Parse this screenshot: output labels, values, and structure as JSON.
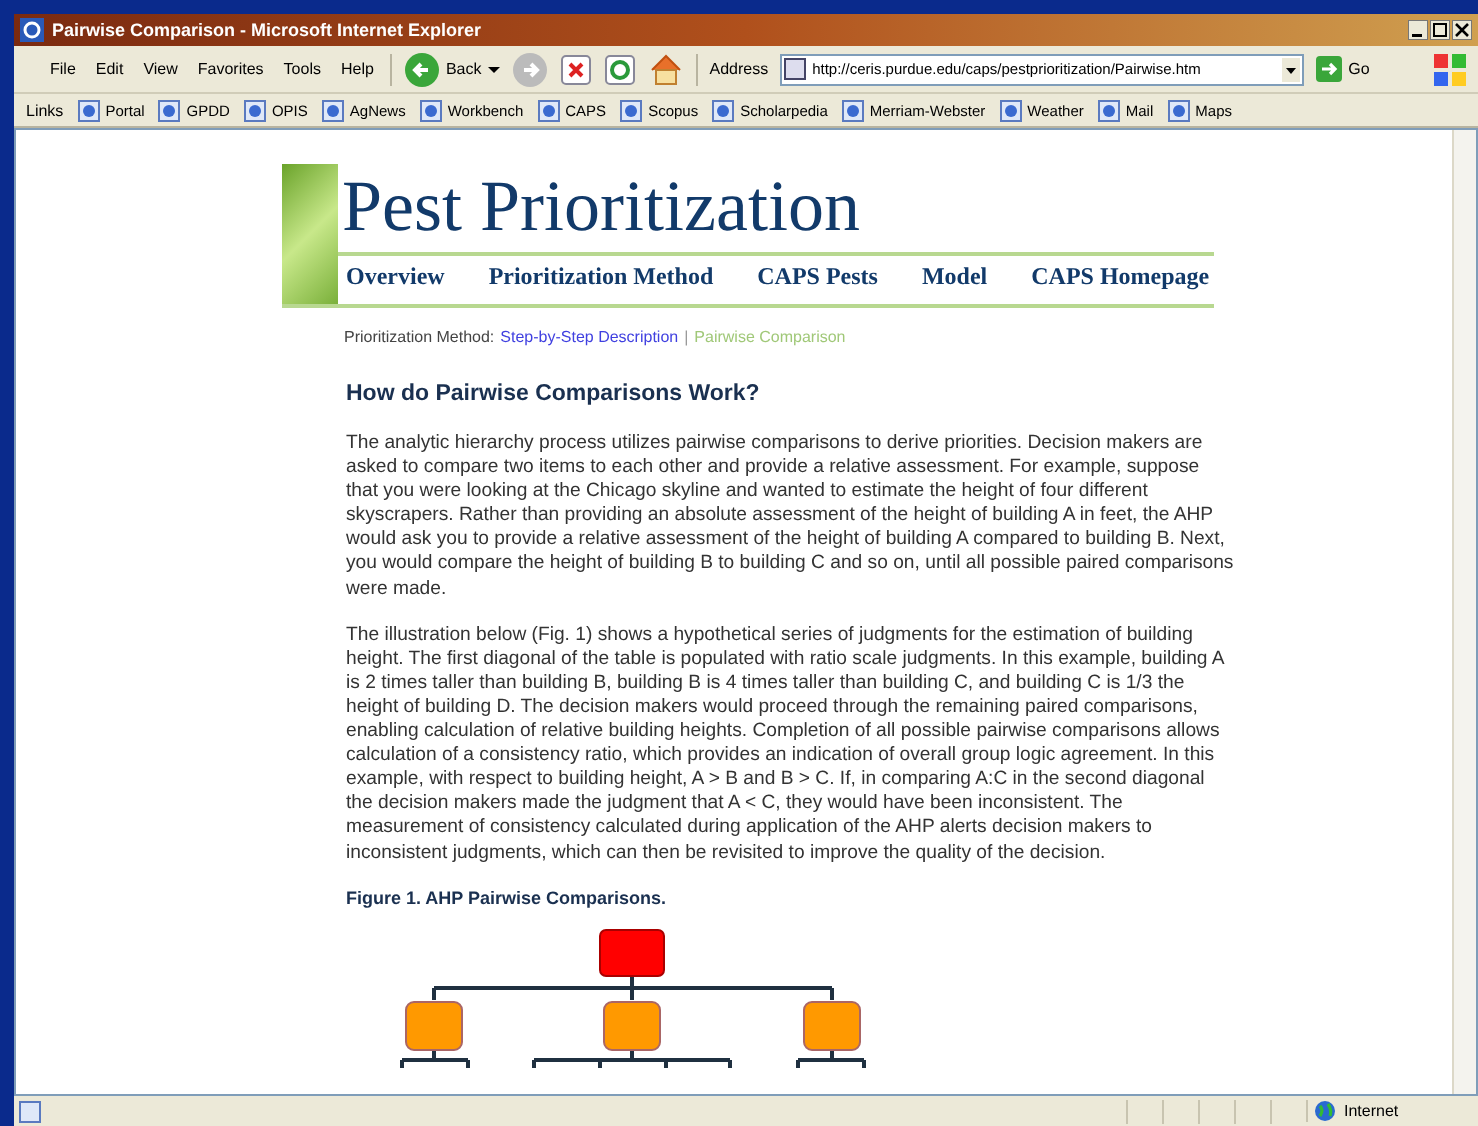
{
  "window": {
    "title": "Pairwise Comparison - Microsoft Internet Explorer"
  },
  "menu": [
    "File",
    "Edit",
    "View",
    "Favorites",
    "Tools",
    "Help"
  ],
  "toolbar": {
    "back": "Back",
    "address_label": "Address",
    "address": "http://ceris.purdue.edu/caps/pestprioritization/Pairwise.htm",
    "go": "Go"
  },
  "links_bar": {
    "label": "Links",
    "links": [
      "Portal",
      "GPDD",
      "OPIS",
      "AgNews",
      "Workbench",
      "CAPS",
      "Scopus",
      "Scholarpedia",
      "Merriam-Webster",
      "Weather",
      "Mail",
      "Maps"
    ]
  },
  "page": {
    "site_title": "Pest Prioritization",
    "nav": [
      "Overview",
      "Prioritization Method",
      "CAPS Pests",
      "Model",
      "CAPS Homepage"
    ],
    "breadcrumb": {
      "label": "Prioritization Method:",
      "link": "Step-by-Step Description",
      "separator": "|",
      "current": "Pairwise Comparison"
    },
    "heading": "How do Pairwise Comparisons Work?",
    "paragraphs": [
      "The analytic hierarchy process utilizes pairwise comparisons to derive priorities. Decision makers are asked to compare two items to each other and provide a relative assessment. For example, suppose that you were looking at the Chicago skyline and wanted to estimate the height of four different skyscrapers. Rather than providing an absolute assessment of the height of building A in feet, the AHP would ask you to provide a relative assessment of the height of building A compared to building B. Next, you would compare the height of building B to building C and so on, until all possible paired comparisons were made.",
      "The illustration below (Fig. 1) shows a hypothetical series of judgments for the estimation of building height. The first diagonal of the table is populated with ratio scale judgments. In this example, building A is 2 times taller than building B, building B is 4 times taller than building C, and building C is 1/3 the height of building D. The decision makers would proceed through the remaining paired comparisons, enabling calculation of relative building heights. Completion of all possible pairwise comparisons allows calculation of a consistency ratio, which provides an indication of overall group logic agreement. In this example, with respect to building height, A > B and B > C. If, in comparing A:C in the second diagonal the decision makers made the judgment that A < C, they would have been inconsistent. The measurement of consistency calculated during application of the AHP alerts decision makers to inconsistent judgments, which can then be revisited to improve the quality of the decision."
    ],
    "figure_caption": "Figure 1. AHP Pairwise Comparisons."
  },
  "status_bar": {
    "zone": "Internet"
  }
}
